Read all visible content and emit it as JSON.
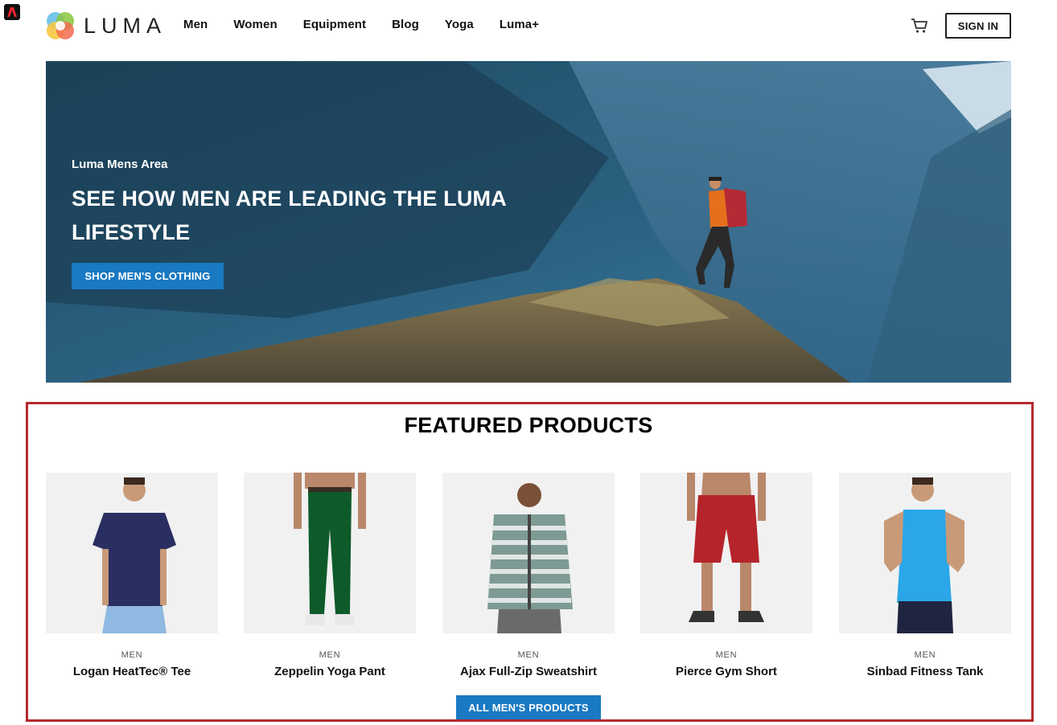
{
  "brand": {
    "name": "LUMA"
  },
  "nav": {
    "items": [
      "Men",
      "Women",
      "Equipment",
      "Blog",
      "Yoga",
      "Luma+"
    ]
  },
  "header": {
    "signin_label": "SIGN IN"
  },
  "hero": {
    "eyebrow": "Luma Mens Area",
    "title": "SEE HOW MEN ARE LEADING THE LUMA LIFESTYLE",
    "cta_label": "SHOP MEN'S CLOTHING"
  },
  "featured": {
    "title": "FEATURED PRODUCTS",
    "products": [
      {
        "category": "MEN",
        "name": "Logan HeatTec® Tee"
      },
      {
        "category": "MEN",
        "name": "Zeppelin Yoga Pant"
      },
      {
        "category": "MEN",
        "name": "Ajax Full-Zip Sweatshirt"
      },
      {
        "category": "MEN",
        "name": "Pierce Gym Short"
      },
      {
        "category": "MEN",
        "name": "Sinbad Fitness Tank"
      }
    ],
    "all_label": "ALL MEN'S PRODUCTS"
  },
  "colors": {
    "accent": "#1979c3",
    "highlight_frame": "#b5292e"
  }
}
